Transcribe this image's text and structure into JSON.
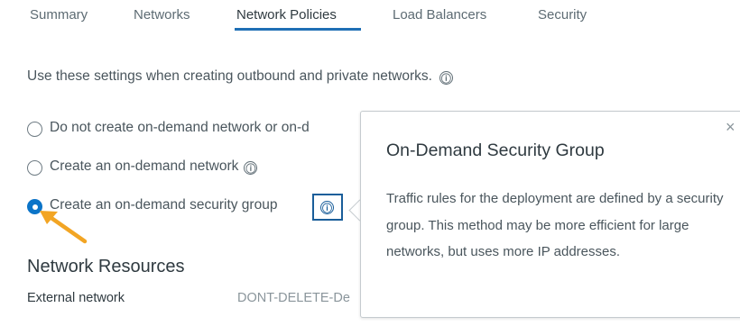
{
  "tabs": [
    {
      "label": "Summary",
      "active": false
    },
    {
      "label": "Networks",
      "active": false
    },
    {
      "label": "Network Policies",
      "active": true
    },
    {
      "label": "Load Balancers",
      "active": false
    },
    {
      "label": "Security",
      "active": false
    }
  ],
  "description": "Use these settings when creating outbound and private networks.",
  "options": [
    {
      "label": "Do not create on-demand network or on-d",
      "checked": false
    },
    {
      "label": "Create an on-demand network",
      "checked": false
    },
    {
      "label": "Create an on-demand security group",
      "checked": true
    }
  ],
  "section": {
    "title": "Network Resources"
  },
  "fields": [
    {
      "label": "External network",
      "value": "DONT-DELETE-De"
    }
  ],
  "popover": {
    "title": "On-Demand Security Group",
    "body": "Traffic rules for the deployment are defined by a security group. This method may be more efficient for large networks, but uses more IP addresses.",
    "close_symbol": "×"
  },
  "icons": {
    "info": "ⓘ"
  },
  "colors": {
    "accent": "#1f6fb5",
    "radio_checked": "#0b74c8",
    "highlight": "#1a5e9a",
    "arrow": "#f2a524"
  }
}
